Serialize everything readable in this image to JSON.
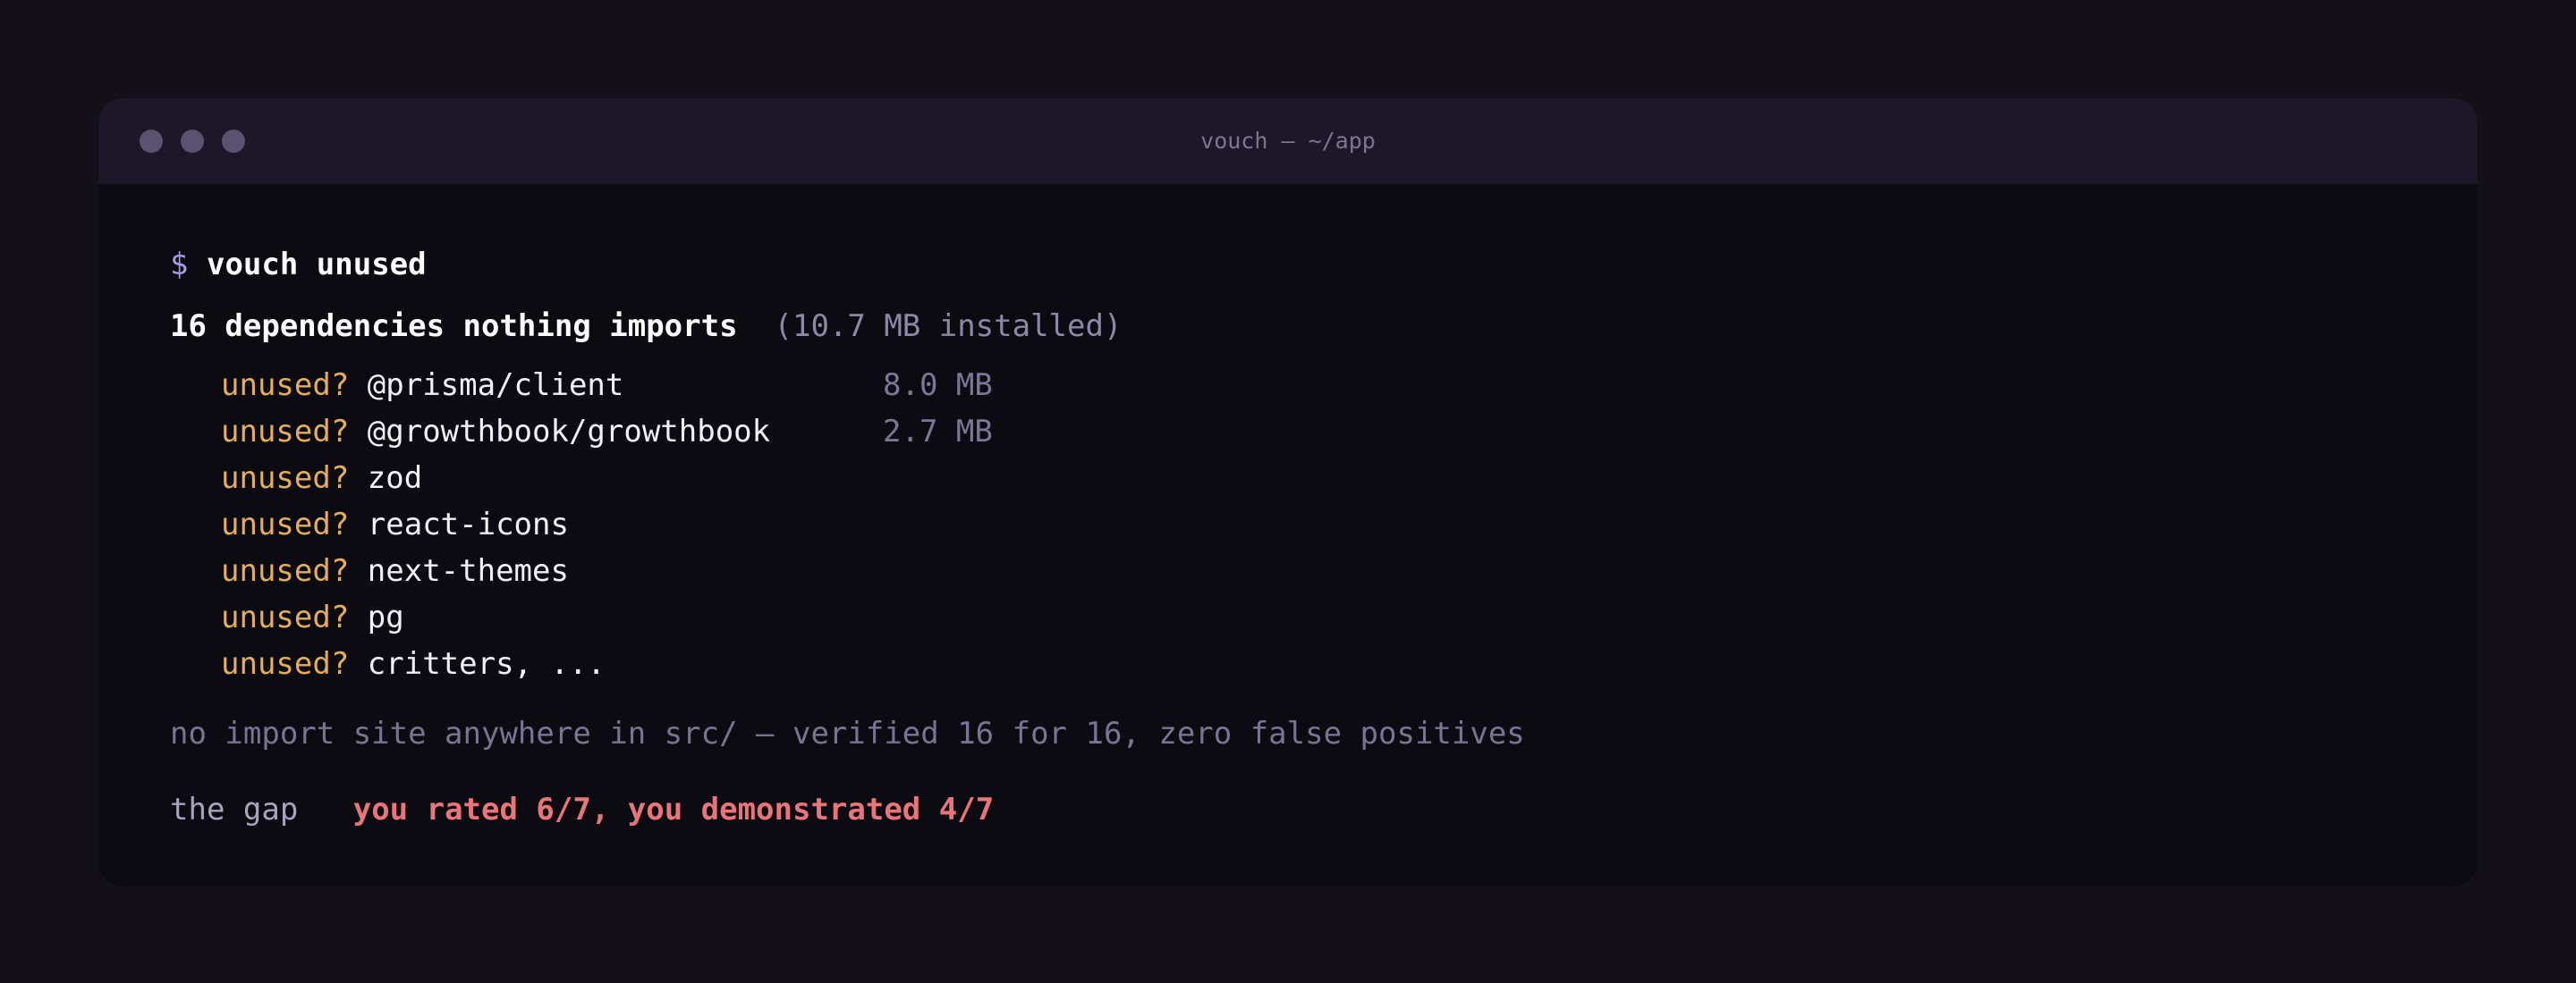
{
  "window": {
    "title": "vouch — ~/app"
  },
  "terminal": {
    "prompt_symbol": "$",
    "command": "vouch unused",
    "summary_heading": "16 dependencies nothing imports",
    "summary_detail": "(10.7 MB installed)",
    "items": [
      {
        "tag": "unused?",
        "name": "@prisma/client",
        "size": "8.0 MB"
      },
      {
        "tag": "unused?",
        "name": "@growthbook/growthbook",
        "size": "2.7 MB"
      },
      {
        "tag": "unused?",
        "name": "zod",
        "size": ""
      },
      {
        "tag": "unused?",
        "name": "react-icons",
        "size": ""
      },
      {
        "tag": "unused?",
        "name": "next-themes",
        "size": ""
      },
      {
        "tag": "unused?",
        "name": "pg",
        "size": ""
      },
      {
        "tag": "unused?",
        "name": "critters, ...",
        "size": ""
      }
    ],
    "note": "no import site anywhere in src/ — verified 16 for 16, zero false positives",
    "gap_label": "the gap",
    "gap_value": "you rated 6/7, you demonstrated 4/7"
  },
  "colors": {
    "background": "#13101a",
    "window": "#0d0b12",
    "titlebar": "#1d1829",
    "prompt": "#a99be0",
    "warning": "#e3ad5c",
    "alert": "#e8757a"
  }
}
